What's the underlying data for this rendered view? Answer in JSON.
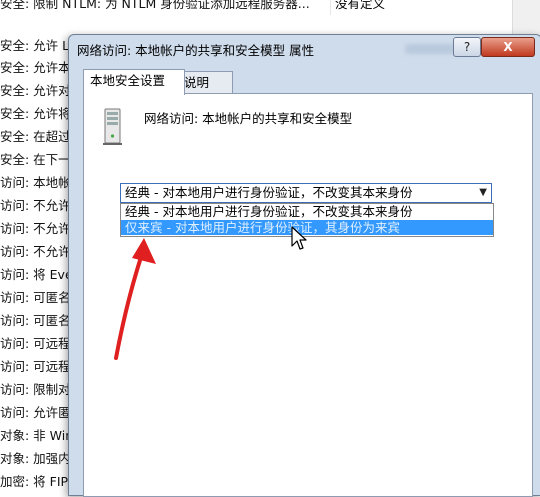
{
  "background": {
    "top_row": {
      "name": "安全: 限制 NTLM: 为 NTLM 身份验证添加远程服务器...",
      "setting": "没有定义"
    },
    "rows": [
      "安全: 允许 Loc",
      "安全: 允许本地",
      "安全: 允许对该",
      "安全: 允许将 P",
      "安全: 在超过登",
      "安全: 在下一次",
      "访问: 本地帐户",
      "访问: 不允许 S",
      "访问: 不允许 S",
      "访问: 不允许存",
      "访问: 将 Every",
      "访问: 可匿名访",
      "访问: 可匿名访",
      "访问: 可远程访",
      "访问: 可远程访",
      "访问: 限制对命",
      "访问: 允许匿名",
      "对象: 非 Wind",
      "对象: 加强内部",
      "加密: 将 FIPS"
    ]
  },
  "dialog": {
    "title": "网络访问: 本地帐户的共享和安全模型 属性",
    "help_label": "?",
    "close_label": "X",
    "tabs": [
      {
        "label": "本地安全设置"
      },
      {
        "label": "说明"
      }
    ],
    "policy_title": "网络访问: 本地帐户的共享和安全模型",
    "combo": {
      "selected": "经典 - 对本地用户进行身份验证，不改变其本来身份",
      "arrow": "▼"
    },
    "options": [
      "经典 - 对本地用户进行身份验证，不改变其本来身份",
      "仅来宾 - 对本地用户进行身份验证，其身份为来宾"
    ]
  },
  "colors": {
    "highlight": "#3399ff",
    "arrow": "#e02020",
    "dialog_frame": "#cfdcec"
  }
}
